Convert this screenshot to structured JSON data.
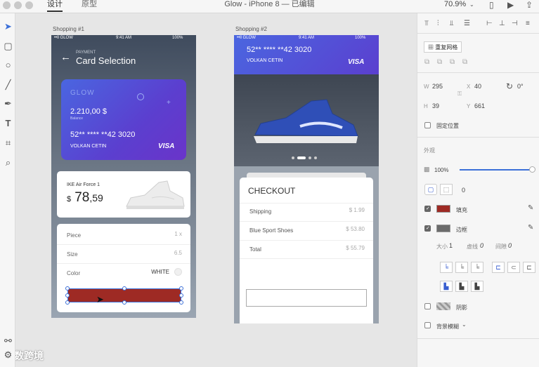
{
  "window": {
    "title": "Glow - iPhone 8 — 已编辑",
    "tabs": [
      "设计",
      "原型"
    ],
    "zoom": "70.9%"
  },
  "artboard1": {
    "label": "Shopping #1",
    "status": {
      "carrier": "••ll GLOW",
      "time": "9:41 AM",
      "battery": "100%"
    },
    "header_small": "PAYMENT",
    "header_title": "Card Selection",
    "card": {
      "brand": "GLOW",
      "balance": "2.210,00 $",
      "balance_label": "Balance",
      "number": "52** **** **42 3020",
      "name": "VOLKAN CETIN",
      "network": "VISA"
    },
    "product": {
      "name": "IKE Air Force 1",
      "currency": "$",
      "price_int": "78",
      "price_dec": ",59"
    },
    "options": [
      {
        "label": "Piece",
        "value": "1 x"
      },
      {
        "label": "Size",
        "value": "6.5"
      },
      {
        "label": "Color",
        "value": "WHITE"
      }
    ]
  },
  "artboard2": {
    "label": "Shopping #2",
    "status": {
      "carrier": "••ll GLOW",
      "time": "9:41 AM",
      "battery": "100%"
    },
    "card_number": "52** **** **42 3020",
    "card_name": "VOLKAN CETIN",
    "card_network": "VISA",
    "checkout_title": "CHECKOUT",
    "rows": [
      {
        "label": "Shipping",
        "value": "$ 1.99"
      },
      {
        "label": "Blue Sport Shoes",
        "value": "$ 53.80"
      },
      {
        "label": "Total",
        "value": "$ 55.79"
      }
    ]
  },
  "inspector": {
    "w_label": "W",
    "w_value": "295",
    "x_label": "X",
    "x_value": "40",
    "rot_value": "0°",
    "h_label": "H",
    "h_value": "39",
    "y_label": "Y",
    "y_value": "661",
    "repeat_grid": "重复网格",
    "fix_position": "固定位置",
    "appearance": "外观",
    "opacity": "100%",
    "radius": "0",
    "fill_label": "填充",
    "fill_color": "#9e2a24",
    "border_label": "边框",
    "border_color": "#6b6b6b",
    "size_label": "大小",
    "size_value": "1",
    "dash_label": "虚线",
    "dash_value": "0",
    "gap_label": "间隙",
    "gap_value": "0",
    "shadow_label": "阴影",
    "bg_blur_label": "背景模糊",
    "fill_checked": true,
    "border_checked": true,
    "shadow_checked": false,
    "blur_checked": false,
    "fix_checked": false
  },
  "watermark": "大数跨境",
  "colors": {
    "accent": "#3b6fd8",
    "card_purple": "#5a3fd0",
    "selected_fill": "#9e2a24"
  }
}
